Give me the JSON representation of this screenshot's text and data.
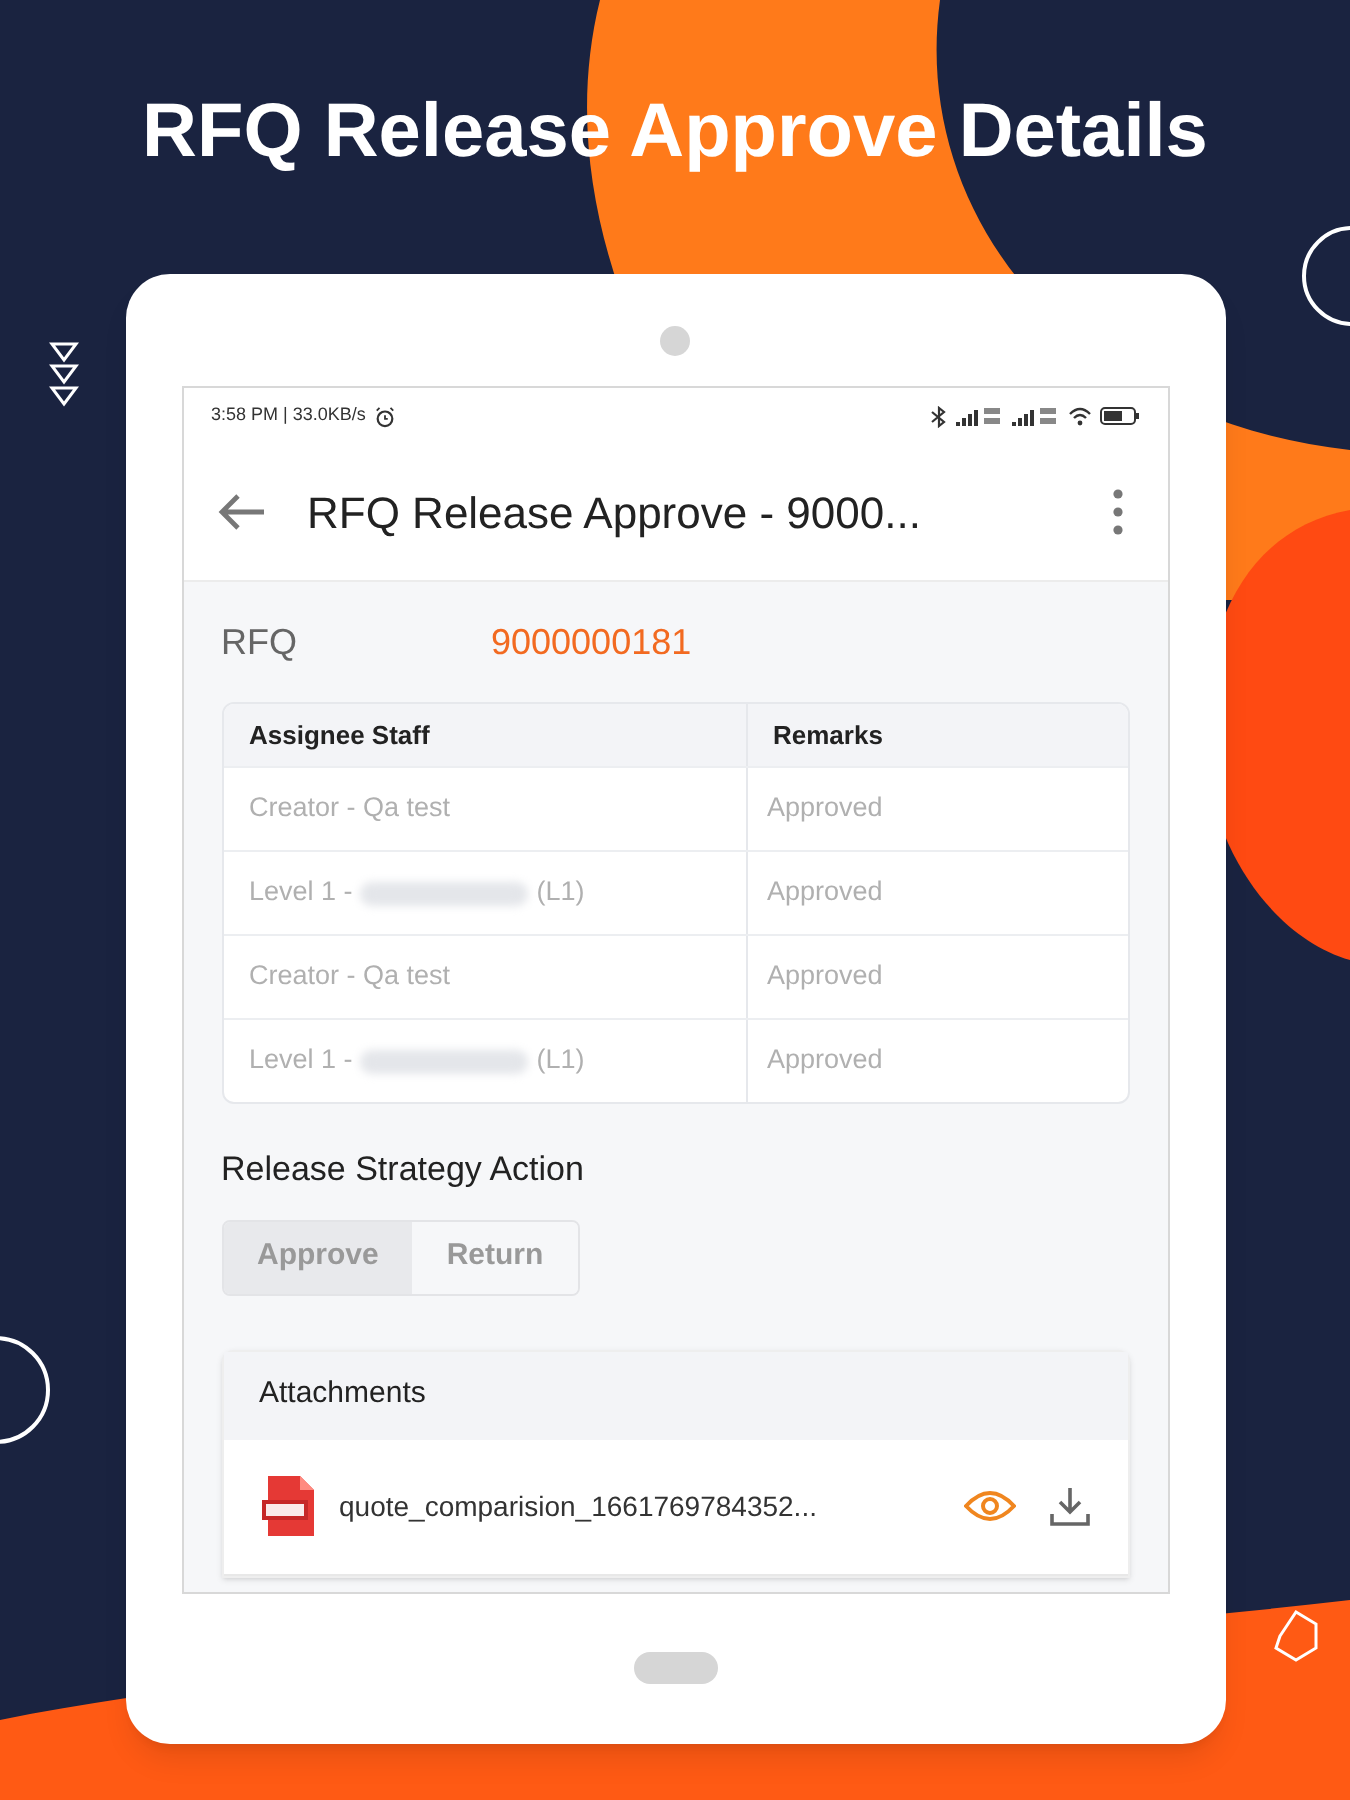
{
  "headline": "RFQ Release Approve Details",
  "status_bar": {
    "time": "3:58 PM | 33.0KB/s"
  },
  "app_bar": {
    "title": "RFQ Release Approve - 9000..."
  },
  "rfq": {
    "label": "RFQ",
    "value": "9000000181"
  },
  "table": {
    "columns": [
      "Assignee Staff",
      "Remarks"
    ],
    "rows": [
      {
        "staff": "Creator - Qa test",
        "redacted": false,
        "suffix": "",
        "remarks": "Approved"
      },
      {
        "staff": "Level 1 -",
        "redacted": true,
        "suffix": "(L1)",
        "remarks": "Approved"
      },
      {
        "staff": "Creator - Qa test",
        "redacted": false,
        "suffix": "",
        "remarks": "Approved"
      },
      {
        "staff": "Level 1 -",
        "redacted": true,
        "suffix": "(L1)",
        "remarks": "Approved"
      }
    ]
  },
  "release_strategy": {
    "title": "Release Strategy Action",
    "options": [
      {
        "label": "Approve",
        "selected": true
      },
      {
        "label": "Return",
        "selected": false
      }
    ]
  },
  "attachments": {
    "title": "Attachments",
    "files": [
      {
        "name": "quote_comparision_1661769784352..."
      }
    ]
  }
}
